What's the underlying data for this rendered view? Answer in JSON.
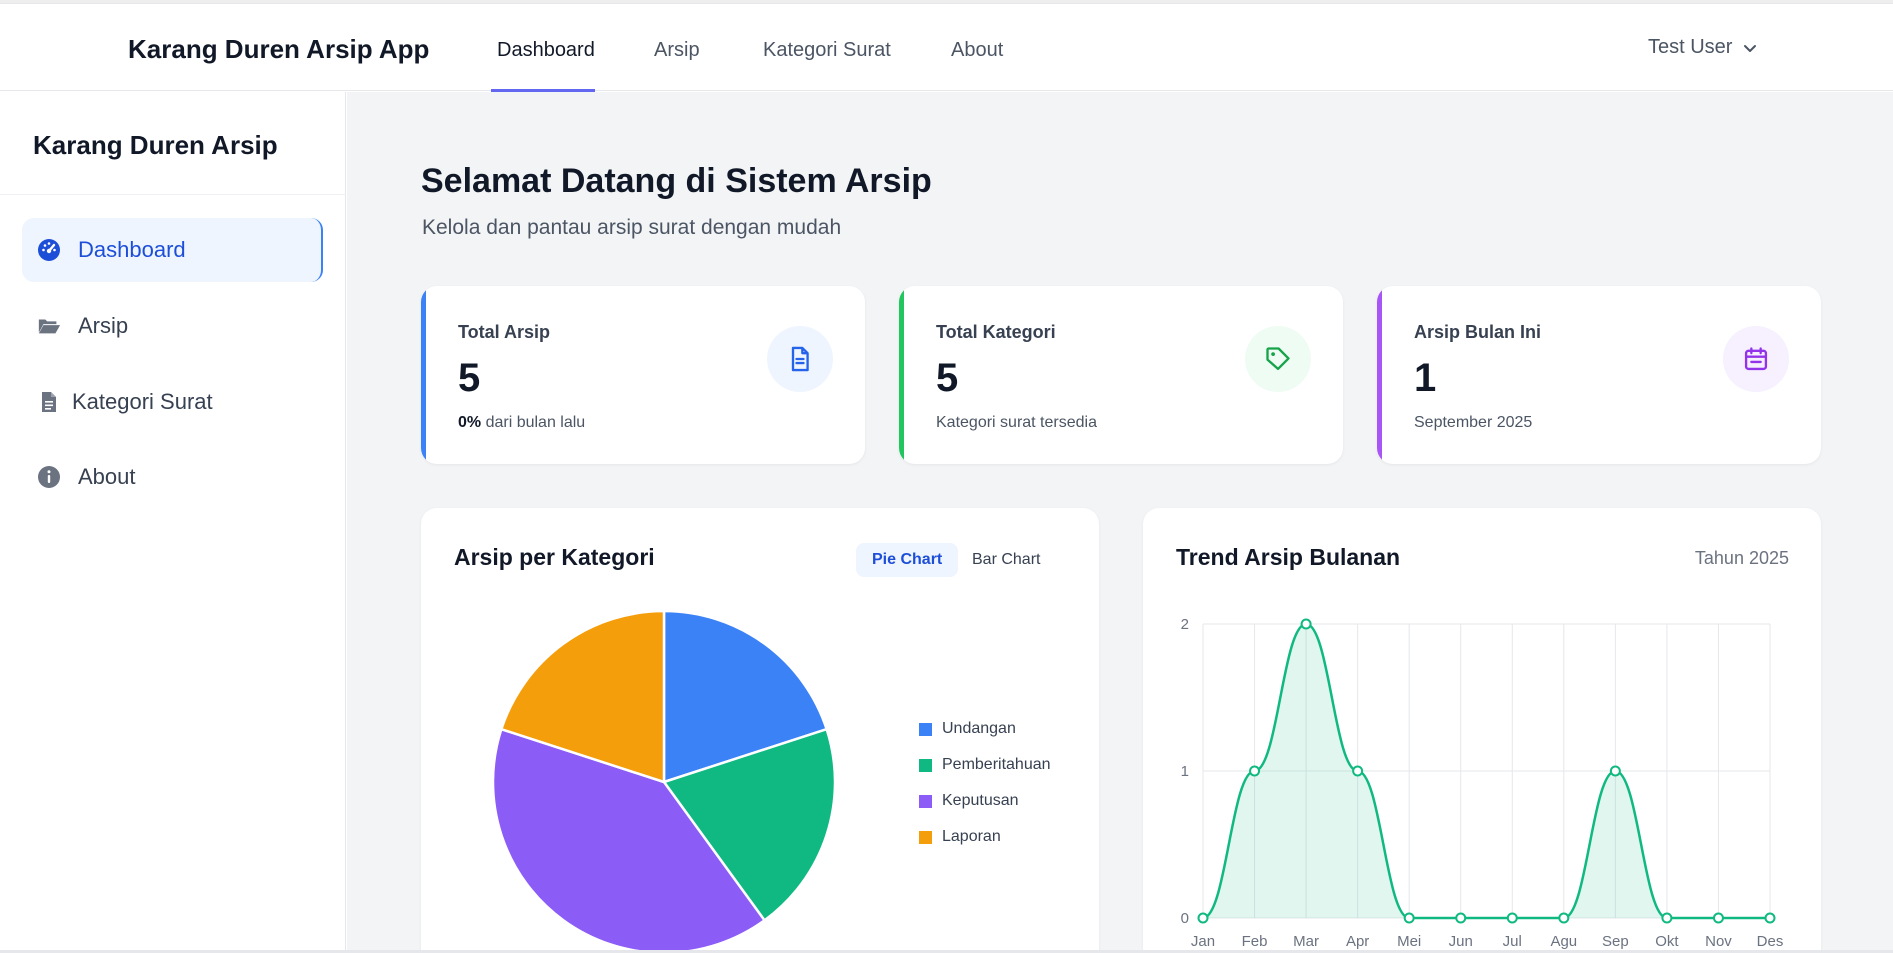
{
  "nav": {
    "brand": "Karang Duren Arsip App",
    "links": [
      "Dashboard",
      "Arsip",
      "Kategori Surat",
      "About"
    ],
    "user": "Test User"
  },
  "sidebar": {
    "title": "Karang Duren Arsip",
    "items": [
      {
        "label": "Dashboard",
        "icon": "gauge-icon"
      },
      {
        "label": "Arsip",
        "icon": "folder-open-icon"
      },
      {
        "label": "Kategori Surat",
        "icon": "file-icon"
      },
      {
        "label": "About",
        "icon": "info-icon"
      }
    ]
  },
  "header": {
    "title": "Selamat Datang di Sistem Arsip",
    "subtitle": "Kelola dan pantau arsip surat dengan mudah"
  },
  "stats": [
    {
      "label": "Total Arsip",
      "value": "5",
      "note_strong": "0%",
      "note": " dari bulan lalu",
      "color": "#3b82f6",
      "icon": "document-icon"
    },
    {
      "label": "Total Kategori",
      "value": "5",
      "note_strong": "",
      "note": "Kategori surat tersedia",
      "color": "#22c55e",
      "icon": "tag-icon"
    },
    {
      "label": "Arsip Bulan Ini",
      "value": "1",
      "note_strong": "",
      "note": "September 2025",
      "color": "#a855f7",
      "icon": "calendar-icon"
    }
  ],
  "category_panel": {
    "title": "Arsip per Kategori",
    "toggle": [
      "Pie Chart",
      "Bar Chart"
    ]
  },
  "trend_panel": {
    "title": "Trend Arsip Bulanan",
    "year_label": "Tahun 2025"
  },
  "chart_data": [
    {
      "type": "pie",
      "categories": [
        "Undangan",
        "Pemberitahuan",
        "Keputusan",
        "Laporan"
      ],
      "values": [
        1,
        1,
        2,
        1
      ],
      "colors": [
        "#3b82f6",
        "#10b981",
        "#8b5cf6",
        "#f59e0b"
      ],
      "legend": "right"
    },
    {
      "type": "area",
      "categories": [
        "Jan",
        "Feb",
        "Mar",
        "Apr",
        "Mei",
        "Jun",
        "Jul",
        "Agu",
        "Sep",
        "Okt",
        "Nov",
        "Des"
      ],
      "values": [
        0,
        1,
        2,
        1,
        0,
        0,
        0,
        0,
        1,
        0,
        0,
        0
      ],
      "ylim": [
        0,
        2
      ],
      "yticks": [
        "0",
        "1",
        "2"
      ],
      "grid": true,
      "color": "#10b981"
    }
  ]
}
